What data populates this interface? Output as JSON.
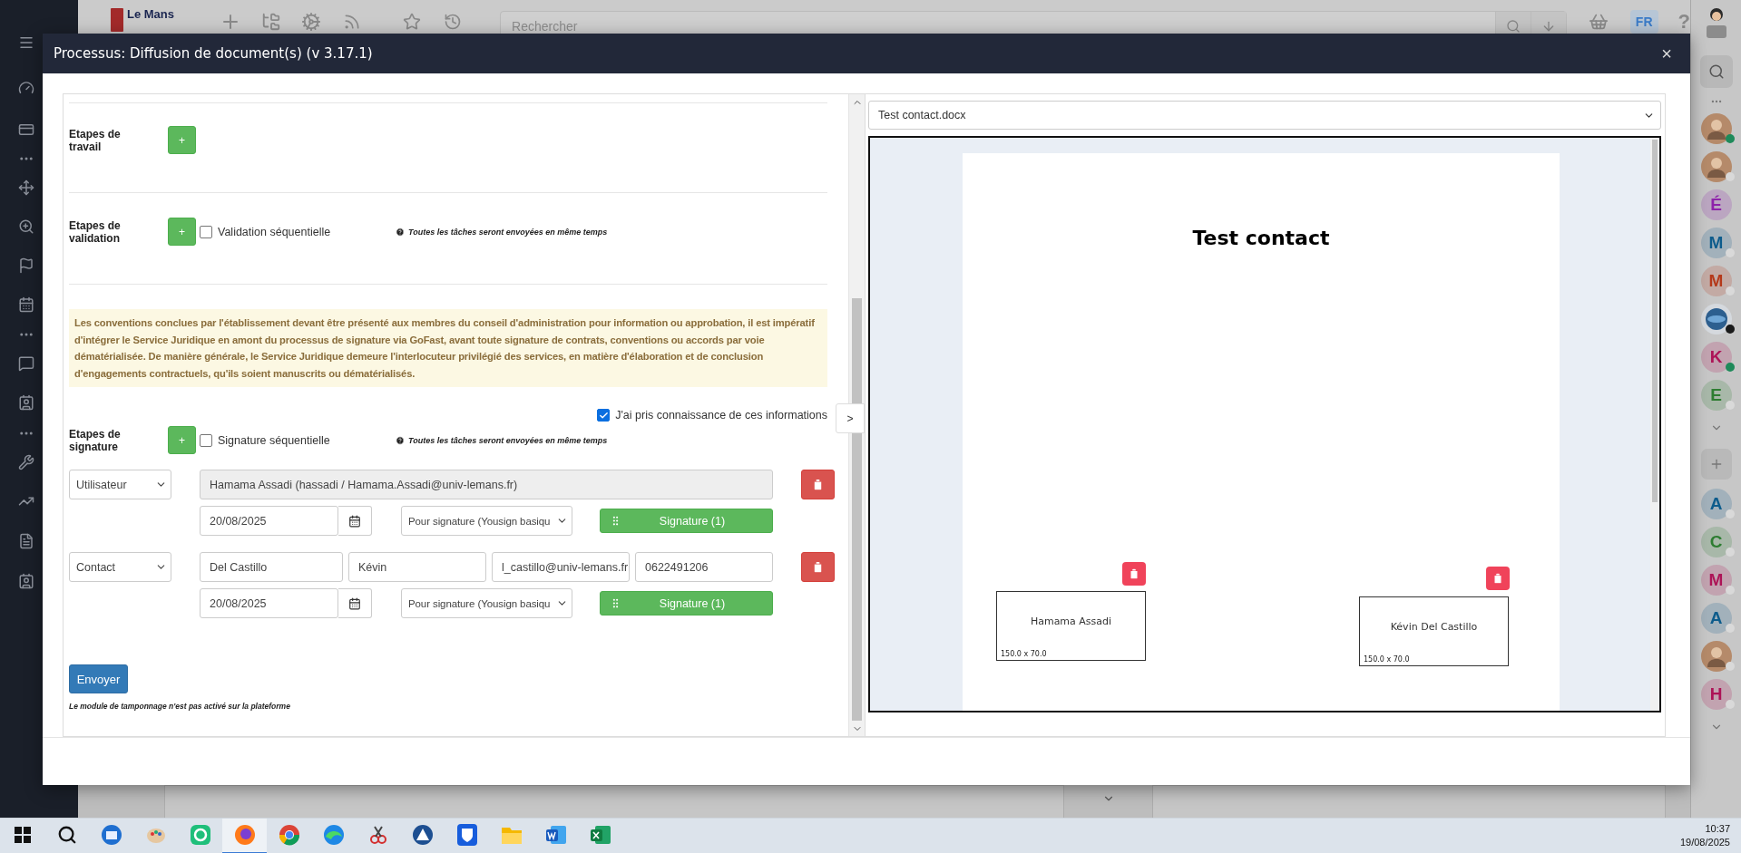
{
  "app_bar": {
    "logo_text": "Le Mans",
    "search_placeholder": "Rechercher",
    "language": "FR",
    "help": "?"
  },
  "modal": {
    "title": "Processus: Diffusion de document(s) (v 3.17.1)",
    "close": "×"
  },
  "work_steps": {
    "label": "Etapes de travail",
    "add": "+"
  },
  "validation_steps": {
    "label": "Etapes de validation",
    "add": "+",
    "sequential": {
      "label": "Validation séquentielle",
      "checked": false
    },
    "note": "Toutes les tâches seront envoyées en même temps"
  },
  "notice": "Les conventions conclues par l'établissement devant être présenté aux membres du conseil d'administration pour information ou approbation, il est impératif d'intégrer le Service Juridique en amont du processus de signature via GoFast, avant toute signature de contrats, conventions ou accords par voie dématérialisée. De manière générale, le Service Juridique demeure l'interlocuteur privilégié des services, en matière d'élaboration et de conclusion d'engagements contractuels, qu'ils soient manuscrits ou dématérialisés.",
  "acknowledge": {
    "label": "J'ai pris connaissance de ces informations",
    "checked": true
  },
  "toggle": ">",
  "signature_steps": {
    "label": "Etapes de signature",
    "add": "+",
    "sequential": {
      "label": "Signature séquentielle",
      "checked": false
    },
    "note": "Toutes les tâches seront envoyées en même temps",
    "signers": [
      {
        "kind": "user",
        "type": "Utilisateur",
        "user": "Hamama Assadi (hassadi / Hamama.Assadi@univ-lemans.fr)",
        "date": "20/08/2025",
        "mode": "Pour signature (Yousign basiqu",
        "signature": "Signature (1)"
      },
      {
        "kind": "contact",
        "type": "Contact",
        "last_name": "Del Castillo",
        "first_name": "Kévin",
        "email": "l_castillo@univ-lemans.fr",
        "phone": "0622491206",
        "date": "20/08/2025",
        "mode": "Pour signature (Yousign basiqu",
        "signature": "Signature (1)"
      }
    ]
  },
  "send": "Envoyer",
  "footnote": "Le module de tamponnage n'est pas activé sur la plateforme",
  "preview": {
    "file": "Test contact.docx",
    "heading": "Test contact",
    "fields": [
      {
        "name": "Hamama Assadi",
        "size": "150.0 x 70.0"
      },
      {
        "name": "Kévin Del Castillo",
        "size": "150.0 x 70.0"
      }
    ]
  },
  "rail": {
    "list_1": [
      {
        "kind": "photo",
        "online": true
      },
      {
        "kind": "photo",
        "online": false
      },
      {
        "kind": "letter",
        "letter": "É",
        "color": "#8e24aa"
      },
      {
        "kind": "letter",
        "letter": "M",
        "color": "#0d5c8c",
        "online": false
      },
      {
        "kind": "letter",
        "letter": "M",
        "color": "#b5391a",
        "online": false
      },
      {
        "kind": "badge",
        "busy": true
      },
      {
        "kind": "letter",
        "letter": "K",
        "color": "#ad1457",
        "online": true
      },
      {
        "kind": "letter",
        "letter": "E",
        "color": "#2e7d32",
        "online": false
      }
    ],
    "list_2": [
      {
        "kind": "letter",
        "letter": "A",
        "color": "#0d5c8c",
        "online": false
      },
      {
        "kind": "letter",
        "letter": "C",
        "color": "#2e7d32",
        "online": false
      },
      {
        "kind": "letter",
        "letter": "M",
        "color": "#ad1457",
        "online": false
      },
      {
        "kind": "letter",
        "letter": "A",
        "color": "#0d5c8c",
        "online": false
      },
      {
        "kind": "photo",
        "online": false
      },
      {
        "kind": "letter",
        "letter": "H",
        "color": "#ad1457",
        "online": false
      }
    ]
  },
  "taskbar": {
    "time": "10:37",
    "date": "19/08/2025"
  }
}
